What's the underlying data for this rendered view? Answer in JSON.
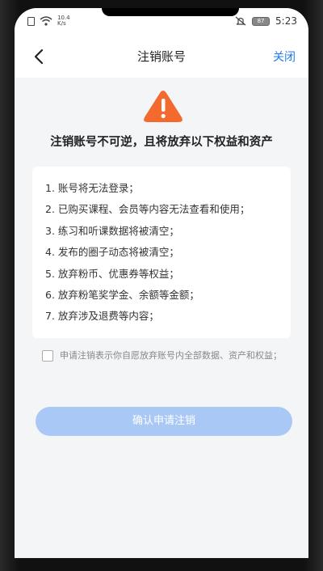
{
  "status_bar": {
    "net_speed_value": "10.4",
    "net_speed_unit": "K/s",
    "battery": "87",
    "time": "5:23"
  },
  "nav": {
    "title": "注销账号",
    "close_label": "关闭"
  },
  "main": {
    "headline": "注销账号不可逆，且将放弃以下权益和资产",
    "items": [
      "1. 账号将无法登录；",
      "2. 已购买课程、会员等内容无法查看和使用；",
      "3. 练习和听课数据将被清空；",
      "4. 发布的圈子动态将被清空；",
      "5. 放弃粉币、优惠券等权益；",
      "6. 放弃粉笔奖学金、余额等金额；",
      "7. 放弃涉及退费等内容；"
    ],
    "agreement_text": "申请注销表示你自愿放弃账号内全部数据、资产和权益；",
    "agreement_checked": false,
    "confirm_label": "确认申请注销"
  },
  "colors": {
    "accent": "#1f7be8",
    "warning": "#f26a2d",
    "button_disabled": "#a9c8f5"
  },
  "icons": [
    "sim-icon",
    "wifi-icon",
    "mute-icon",
    "battery-icon",
    "back-arrow-icon",
    "warning-icon"
  ]
}
